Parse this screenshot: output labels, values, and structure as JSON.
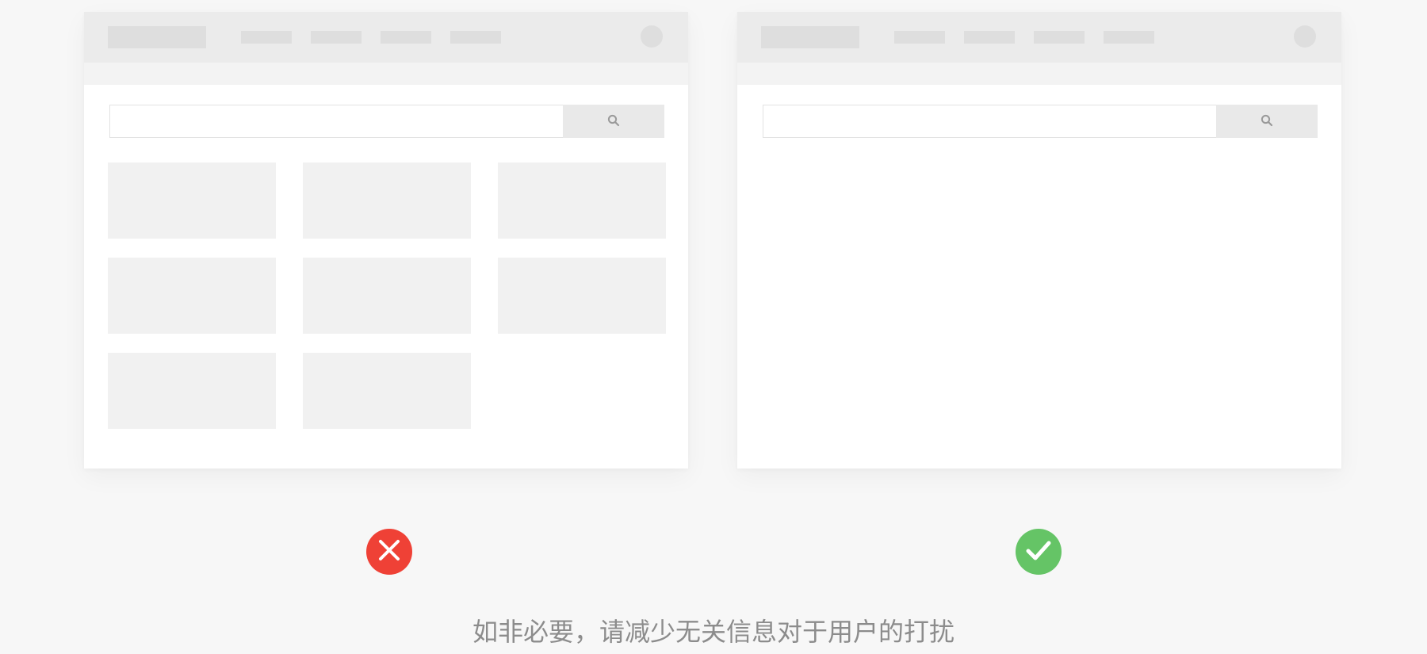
{
  "caption": "如非必要，请减少无关信息对于用户的打扰",
  "examples": {
    "wrong": {
      "verdict_icon": "cross-icon",
      "card_count": 8
    },
    "right": {
      "verdict_icon": "check-icon",
      "card_count": 0
    }
  },
  "mockup": {
    "nav_item_count": 4,
    "search_icon": "search-icon"
  },
  "colors": {
    "background": "#f7f7f7",
    "header": "#ebebeb",
    "placeholder": "#dedede",
    "card": "#f1f1f1",
    "search_button": "#e9e9e9",
    "wrong": "#ef4136",
    "right": "#65c466",
    "caption": "#8c8c8c"
  }
}
